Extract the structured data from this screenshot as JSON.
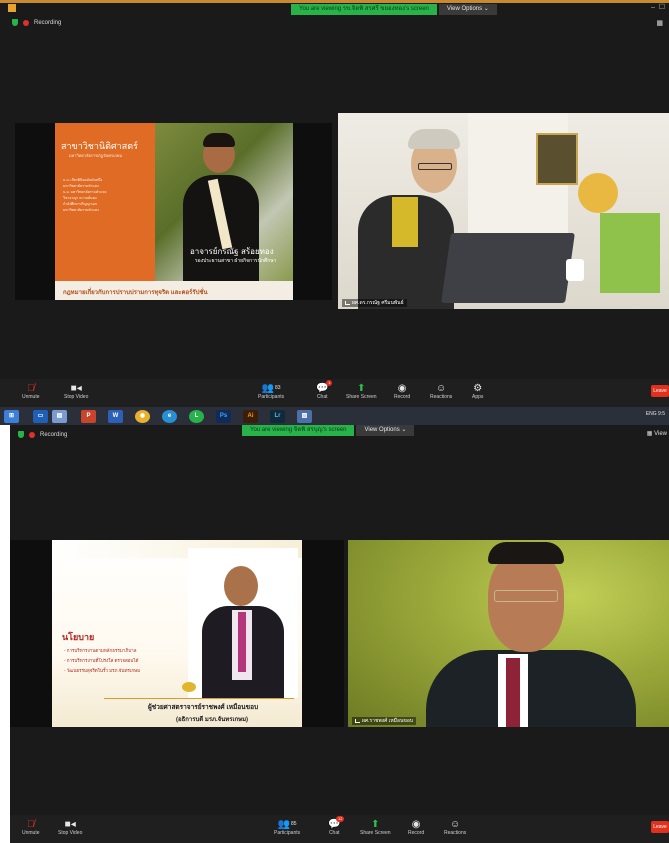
{
  "shot1": {
    "banner": {
      "viewing": "You are viewing รข.จิตพิ สรศรี ขยองทอง's screen",
      "view_options": "View Options ⌄"
    },
    "recording": "Recording",
    "tiles": {
      "slide": {
        "heading": "สาขาวิชานิติศาสตร์",
        "subheading": "มหาวิทยาลัยราชภัฏจันทรเกษม",
        "bullets": [
          "น.บ. เกียรตินิยมอันดับหนึ่ง",
          "มหาวิทยาลัยรามคำแหง",
          "น.ม. มหาวิทยาลัยรามคำแหง",
          "วิชาอาญา ความมั่นคง",
          "กำลังศึกษาปริญญาเอก",
          "มหาวิทยาลัยรามคำแหง"
        ],
        "name": "อาจารย์กรณัฐ สร้อยทอง",
        "role": "รองประธานสาขา ฝ่ายกิจการนักศึกษา",
        "footer": "กฎหมายเกี่ยวกับการปราบปรามการทุจริต และคอร์รัปชั่น"
      },
      "camera": {
        "name_tag": "ผศ.ดร.กรณัฐ ศรีมนพันธ์"
      }
    },
    "toolbar": {
      "unmute": "Unmute",
      "stop_video": "Stop Video",
      "participants": "Participants",
      "participants_count": "83",
      "chat": "Chat",
      "chat_badge": "1",
      "share_screen": "Share Screen",
      "record": "Record",
      "reactions": "Reactions",
      "apps": "Apps",
      "leave": "Leave"
    },
    "taskbar": {
      "tray": "ENG 9:5"
    }
  },
  "shot2": {
    "banner": {
      "viewing": "You are viewing จิตพิ สรบุญ's screen",
      "view_options": "View Options ⌄"
    },
    "recording": "Recording",
    "view_label": "View",
    "tiles": {
      "slide": {
        "heading": "นโยบาย",
        "bullets": [
          "- การบริหารงานตามหลักธรรมาภิบาล",
          "- การบริหารงานที่โปร่งใส ตรวจสอบได้",
          "- วัฒนธรรมสุจริตในรั้ว มรภ.จันทรเกษม"
        ],
        "name": "ผู้ช่วยศาสตราจารย์ราชพงศ์ เหมือนขอบ",
        "role": "(อธิการบดี มรภ.จันทรเกษม)"
      },
      "camera": {
        "name_tag": "ผศ.ราชพงศ์ เหมือนขอบ"
      }
    },
    "toolbar": {
      "unmute": "Unmute",
      "stop_video": "Stop Video",
      "participants": "Participants",
      "participants_count": "85",
      "chat": "Chat",
      "chat_badge": "12",
      "share_screen": "Share Screen",
      "record": "Record",
      "reactions": "Reactions",
      "leave": "Leave"
    }
  }
}
